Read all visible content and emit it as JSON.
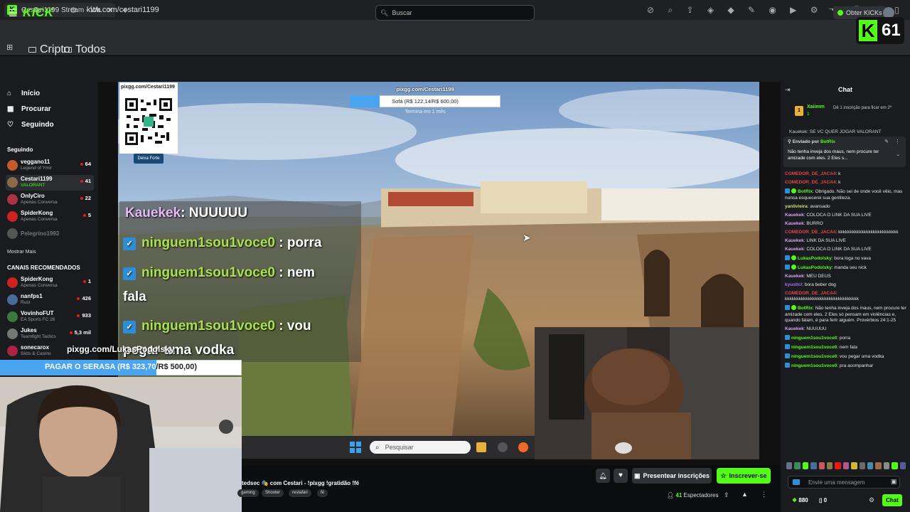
{
  "browser": {
    "tab_title": "Cestari1199 Stream - Watch L",
    "url": "kick.com/cestari1199",
    "bookmarks": [
      "Cripto",
      "Todos"
    ],
    "overlay_counter": "61"
  },
  "header": {
    "logo": "KICK",
    "search_placeholder": "Buscar",
    "obter_label": "Obter KICKs"
  },
  "sidebar": {
    "nav": [
      {
        "label": "Início",
        "icon": "home-icon"
      },
      {
        "label": "Procurar",
        "icon": "browse-icon"
      },
      {
        "label": "Seguindo",
        "icon": "heart-icon"
      }
    ],
    "following_title": "Seguindo",
    "following": [
      {
        "name": "veggano11",
        "category": "Legend of Ymir",
        "viewers": "64",
        "color": "#c45a2a"
      },
      {
        "name": "Cestari1199",
        "category": "VALORANT",
        "viewers": "41",
        "color": "#8a6a4a"
      },
      {
        "name": "OnlyCiro",
        "category": "Apenas Conversa",
        "viewers": "22",
        "color": "#aa3344"
      },
      {
        "name": "SpiderKong",
        "category": "Apenas Conversa",
        "viewers": "5",
        "color": "#cc2222"
      },
      {
        "name": "Pelegrino1993",
        "category": "",
        "viewers": "",
        "color": "#555555"
      }
    ],
    "show_more": "Mostrar Mais",
    "recommended_title": "CANAIS RECOMENDADOS",
    "recommended": [
      {
        "name": "SpiderKong",
        "category": "Apenas Conversa",
        "viewers": "1",
        "color": "#cc2222"
      },
      {
        "name": "nanfps1",
        "category": "Rust",
        "viewers": "426",
        "color": "#4a6a9a"
      },
      {
        "name": "VovinhoFUT",
        "category": "EA Sports FC 26",
        "viewers": "933",
        "color": "#3a7a3a"
      },
      {
        "name": "Jukes",
        "category": "Teamfight Tactics",
        "viewers": "5,3 mil",
        "color": "#777777"
      },
      {
        "name": "sonecarox",
        "category": "Slots & Casino",
        "viewers": "",
        "color": "#aa2244"
      }
    ]
  },
  "stream": {
    "qr_title": "pixgg.com/Cestari1199",
    "qr_button": "Deixa Forte",
    "goal_top": {
      "label": "pixgg.com/Cestari1199",
      "text": "Sofá (R$ 122,14/R$ 600,00)",
      "sub": "Termina em 1 mês",
      "progress": 0.2
    },
    "overlay_chat": [
      {
        "user": "Kauekek",
        "text": ": NUUUUU",
        "badge": false,
        "purple": true
      },
      {
        "user": "ninguem1sou1voce0",
        "text": ": porra",
        "badge": true
      },
      {
        "user": "ninguem1sou1voce0",
        "text": ": nem",
        "badge": true,
        "cont": "fala"
      },
      {
        "user": "ninguem1sou1voce0",
        "text": ": vou",
        "badge": true,
        "cont": "pegar uma vodka"
      }
    ],
    "goal_bottom": {
      "label": "pixgg.com/LukasPodolsky",
      "text_filled": "PAGAR O SERASA (R$ 323,70",
      "text_rest": "/R$ 500,00)",
      "progress": 0.647
    },
    "taskbar_search": "Pesquisar"
  },
  "info": {
    "title": "tedsec 🎭 com Cestari - !pixgg !gratidão !fé",
    "tags": [
      "gaming",
      "Shooter",
      "restafari",
      "fé"
    ],
    "gift_label": "Presentear inscrições",
    "subscribe_label": "Inscrever-se",
    "viewers_count": "41",
    "viewers_label": "Espectadores"
  },
  "chat": {
    "title": "Chat",
    "top_gifter": {
      "name": "Xaiimm",
      "count": "1",
      "text": "Dê 1 inscrição para ficar em 2º"
    },
    "top_line": "Kauekek: SE VC QUER JOGAR VALORANT",
    "pinned": {
      "by_label": "Enviado por",
      "by_user": "BotRix",
      "text": "Não tenha inveja dos maus, nem procure ter amizade com eles. 2 Eles s..."
    },
    "messages": [
      {
        "user": "COMEDOR_DE_JACA4",
        "text": ": k",
        "color": "#e04848",
        "badge": ""
      },
      {
        "user": "COMEDOR_DE_JACA4",
        "text": ": k",
        "color": "#e04848",
        "badge": ""
      },
      {
        "user": "BotRix",
        "text": ": Obrigado. Não sei de onde você vêio, mas nunca esquecerei sua gentileza.",
        "color": "#53fc18",
        "badge": "bot"
      },
      {
        "user": "yanlivieira",
        "text": ": avansado",
        "color": "#c8e26a",
        "badge": ""
      },
      {
        "user": "Kauekek",
        "text": ": COLOCA O LINK DA SUA LIVE",
        "color": "#d4a6f0",
        "badge": ""
      },
      {
        "user": "Kauekek",
        "text": ": BURRO",
        "color": "#d4a6f0",
        "badge": ""
      },
      {
        "user": "COMEDOR_DE_JACA4",
        "text": ": kkkkkkkkkkkkkkkkkkkkkkkkkk",
        "color": "#e04848",
        "badge": ""
      },
      {
        "user": "Kauekek",
        "text": ": LINK DA SUA LIVE",
        "color": "#d4a6f0",
        "badge": ""
      },
      {
        "user": "Kauekek",
        "text": ": COLOCA O LINK DA SUA LIVE",
        "color": "#d4a6f0",
        "badge": ""
      },
      {
        "user": "LukasPodolsky",
        "text": ": bora loga no vava",
        "color": "#53fc18",
        "badge": "sub"
      },
      {
        "user": "LukasPodolsky",
        "text": ": manda seu nick",
        "color": "#53fc18",
        "badge": "sub"
      },
      {
        "user": "Kauekek",
        "text": ": MEU DEUS",
        "color": "#d4a6f0",
        "badge": ""
      },
      {
        "user": "kyusticl",
        "text": ": bora beber dog",
        "color": "#a070f0",
        "badge": ""
      },
      {
        "user": "COMEDOR_DE_JACA4",
        "text": ": kkkkkkkkkkkkkkkkkkkkkkkkkkkkkkkk",
        "color": "#e04848",
        "badge": ""
      },
      {
        "user": "BotRix",
        "text": ": Não tenha inveja dos maus, nem procure ter amizade com eles. 2 Eles só pensam em violências e, quando falam, é para ferir alguém. Provérbios 24:1-25",
        "color": "#53fc18",
        "badge": "bot"
      },
      {
        "user": "Kauekek",
        "text": ": NUUUUU",
        "color": "#d4a6f0",
        "badge": ""
      },
      {
        "user": "ninguem1sou1voce0",
        "text": ": porra",
        "color": "#53fc18",
        "badge": "sub"
      },
      {
        "user": "ninguem1sou1voce0",
        "text": ": nem fala",
        "color": "#53fc18",
        "badge": "sub"
      },
      {
        "user": "ninguem1sou1voce0",
        "text": ": vou pegar uma vodka",
        "color": "#53fc18",
        "badge": "sub"
      },
      {
        "user": "ninguem1sou1voce0",
        "text": ": pra acompanhar",
        "color": "#53fc18",
        "badge": "sub"
      }
    ],
    "input_placeholder": "Envie uma mensagem",
    "points_a": "880",
    "points_b": "0",
    "chat_button": "Chat"
  }
}
